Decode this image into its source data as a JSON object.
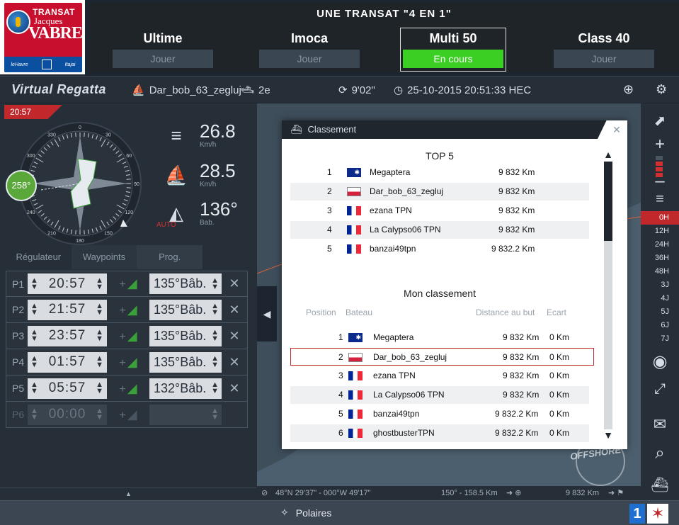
{
  "logo": {
    "line1": "TRANSAT",
    "line2": "Jacques",
    "line3": "VABRE",
    "sponsor1": "leHavre",
    "sponsor2": "Itajai"
  },
  "race": {
    "title": "UNE TRANSAT \"4 EN 1\"",
    "classes": [
      {
        "name": "Ultime",
        "action": "Jouer"
      },
      {
        "name": "Imoca",
        "action": "Jouer"
      },
      {
        "name": "Multi 50",
        "action": "En cours"
      },
      {
        "name": "Class 40",
        "action": "Jouer"
      }
    ]
  },
  "toolbar": {
    "brand": "Virtual Regatta",
    "boat": "Dar_bob_63_zegluj",
    "rank": "2e",
    "refresh": "9'02\"",
    "datetime": "25-10-2015 20:51:33 HEC"
  },
  "panel": {
    "clock": "20:57",
    "heading": "258°",
    "compass_labels": [
      "0",
      "30",
      "60",
      "90",
      "120",
      "150",
      "180",
      "210",
      "240",
      "270",
      "300",
      "330"
    ],
    "wind_speed": "26.8",
    "wind_unit": "Km/h",
    "boat_speed": "28.5",
    "boat_unit": "Km/h",
    "angle": "136°",
    "angle_unit": "Bab.",
    "auto": "AUTO",
    "tabs": [
      "Régulateur",
      "Waypoints",
      "Prog."
    ]
  },
  "waypoints": [
    {
      "label": "P1",
      "time": "20:57",
      "heading": "135°Bâb.",
      "enabled": true
    },
    {
      "label": "P2",
      "time": "21:57",
      "heading": "135°Bâb.",
      "enabled": true
    },
    {
      "label": "P3",
      "time": "23:57",
      "heading": "135°Bâb.",
      "enabled": true
    },
    {
      "label": "P4",
      "time": "01:57",
      "heading": "135°Bâb.",
      "enabled": true
    },
    {
      "label": "P5",
      "time": "05:57",
      "heading": "132°Bâb.",
      "enabled": true
    },
    {
      "label": "P6",
      "time": "00:00",
      "heading": "",
      "enabled": false
    }
  ],
  "forecast": [
    "0H",
    "12H",
    "24H",
    "36H",
    "48H",
    "3J",
    "4J",
    "5J",
    "6J",
    "7J"
  ],
  "map": {
    "coords": "48°N 29'37\" - 000°W 49'17\"",
    "heading_info": "150° - 158.5 Km",
    "distance": "9 832 Km",
    "watermark": "OFFSHORE"
  },
  "bottom": {
    "polaires": "Polaires",
    "badge": "1"
  },
  "ranking": {
    "title": "Classement",
    "top5_title": "TOP 5",
    "top5": [
      {
        "pos": "1",
        "flag": "au",
        "name": "Megaptera",
        "distance": "9 832 Km"
      },
      {
        "pos": "2",
        "flag": "pl",
        "name": "Dar_bob_63_zegluj",
        "distance": "9 832 Km"
      },
      {
        "pos": "3",
        "flag": "fr",
        "name": "ezana TPN",
        "distance": "9 832 Km"
      },
      {
        "pos": "4",
        "flag": "fr",
        "name": "La Calypso06 TPN",
        "distance": "9 832 Km"
      },
      {
        "pos": "5",
        "flag": "fr",
        "name": "banzai49tpn",
        "distance": "9 832.2 Km"
      }
    ],
    "mine_title": "Mon classement",
    "columns": {
      "position": "Position",
      "boat": "Bateau",
      "distance": "Distance au but",
      "gap": "Ecart"
    },
    "mine": [
      {
        "pos": "1",
        "flag": "au",
        "name": "Megaptera",
        "distance": "9 832 Km",
        "gap": "0 Km"
      },
      {
        "pos": "2",
        "flag": "pl",
        "name": "Dar_bob_63_zegluj",
        "distance": "9 832 Km",
        "gap": "0 Km"
      },
      {
        "pos": "3",
        "flag": "fr",
        "name": "ezana TPN",
        "distance": "9 832 Km",
        "gap": "0 Km"
      },
      {
        "pos": "4",
        "flag": "fr",
        "name": "La Calypso06 TPN",
        "distance": "9 832 Km",
        "gap": "0 Km"
      },
      {
        "pos": "5",
        "flag": "fr",
        "name": "banzai49tpn",
        "distance": "9 832.2 Km",
        "gap": "0 Km"
      },
      {
        "pos": "6",
        "flag": "fr",
        "name": "ghostbusterTPN",
        "distance": "9 832.2 Km",
        "gap": "0 Km"
      }
    ]
  },
  "colors": {
    "accent_red": "#c0282c",
    "active_green": "#3bcf24",
    "panel_bg": "#262e37",
    "map_bg": "#4c5f6e"
  }
}
